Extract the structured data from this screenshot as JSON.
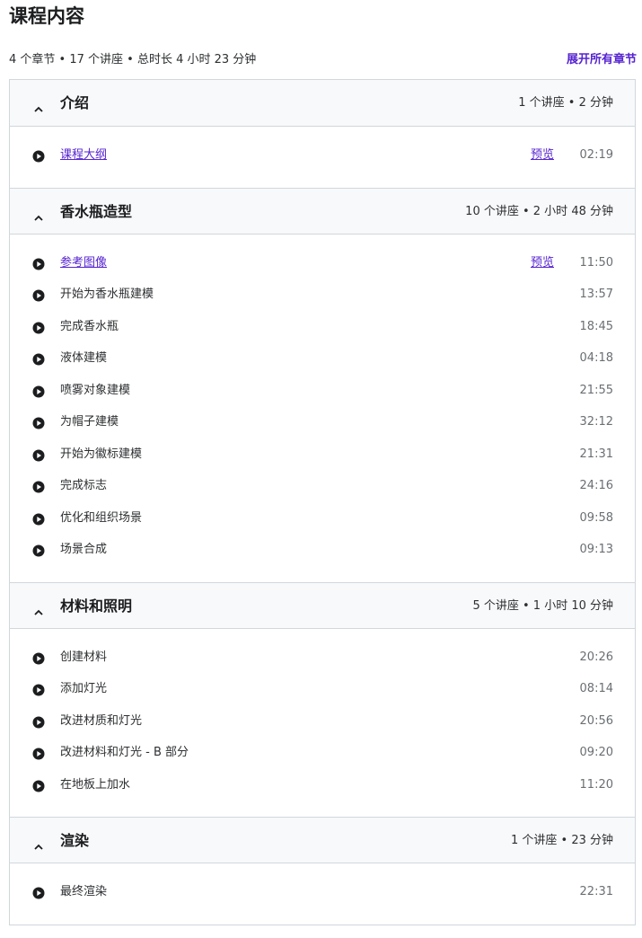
{
  "header": {
    "title": "课程内容",
    "summary": "4 个章节 • 17 个讲座 • 总时长 4 小时 23 分钟",
    "expand_all": "展开所有章节"
  },
  "icons": {
    "section_toggle": "chevron-up-icon",
    "lecture": "play-circle-icon"
  },
  "colors": {
    "link": "#5624d0",
    "section_bg": "#f7f9fa",
    "border": "#d1d7dc"
  },
  "sections": [
    {
      "title": "介绍",
      "meta": "1 个讲座 • 2 分钟",
      "lectures": [
        {
          "title": "课程大纲",
          "preview": "预览",
          "duration": "02:19"
        }
      ]
    },
    {
      "title": "香水瓶造型",
      "meta": "10 个讲座 • 2 小时 48 分钟",
      "lectures": [
        {
          "title": "参考图像",
          "preview": "预览",
          "duration": "11:50"
        },
        {
          "title": "开始为香水瓶建模",
          "duration": "13:57"
        },
        {
          "title": "完成香水瓶",
          "duration": "18:45"
        },
        {
          "title": "液体建模",
          "duration": "04:18"
        },
        {
          "title": "喷雾对象建模",
          "duration": "21:55"
        },
        {
          "title": "为帽子建模",
          "duration": "32:12"
        },
        {
          "title": "开始为徽标建模",
          "duration": "21:31"
        },
        {
          "title": "完成标志",
          "duration": "24:16"
        },
        {
          "title": "优化和组织场景",
          "duration": "09:58"
        },
        {
          "title": "场景合成",
          "duration": "09:13"
        }
      ]
    },
    {
      "title": "材料和照明",
      "meta": "5 个讲座 • 1 小时 10 分钟",
      "lectures": [
        {
          "title": "创建材料",
          "duration": "20:26"
        },
        {
          "title": "添加灯光",
          "duration": "08:14"
        },
        {
          "title": "改进材质和灯光",
          "duration": "20:56"
        },
        {
          "title": "改进材料和灯光 - B 部分",
          "duration": "09:20"
        },
        {
          "title": "在地板上加水",
          "duration": "11:20"
        }
      ]
    },
    {
      "title": "渲染",
      "meta": "1 个讲座 • 23 分钟",
      "lectures": [
        {
          "title": "最终渲染",
          "duration": "22:31"
        }
      ]
    }
  ]
}
